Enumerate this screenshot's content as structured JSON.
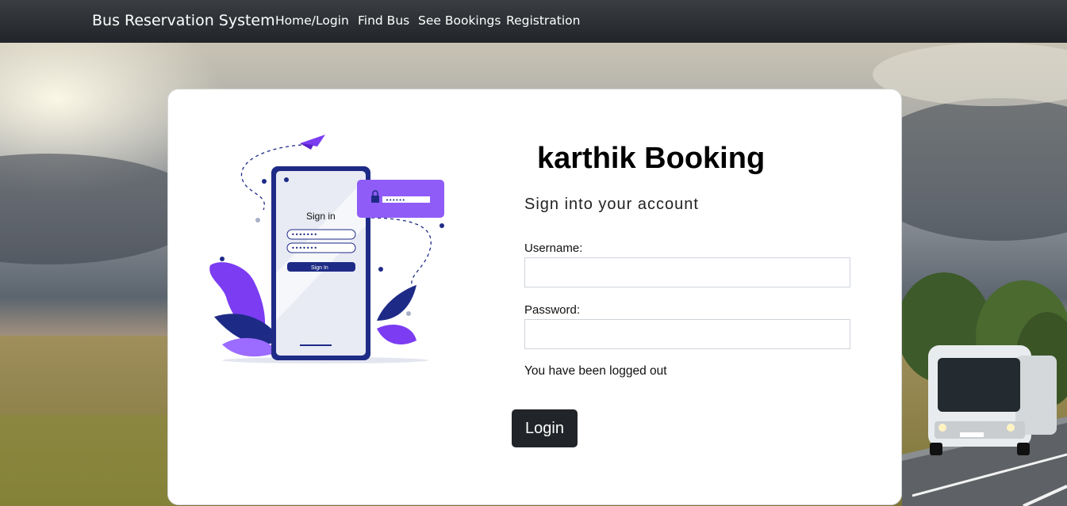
{
  "navbar": {
    "brand": "Bus Reservation System",
    "links": [
      "Home/Login",
      "Find Bus",
      "See Bookings",
      "Registration"
    ]
  },
  "login_card": {
    "title": "karthik Booking",
    "subtitle": "Sign into your account",
    "username_label": "Username:",
    "username_value": "",
    "password_label": "Password:",
    "password_value": "",
    "status_message": "You have been logged out",
    "submit_label": "Login"
  },
  "illustration": {
    "phone_title": "Sign in",
    "phone_button": "Sign In",
    "masked_password": "••••••",
    "masked_field": "•••••••"
  },
  "colors": {
    "navbar": "#212529",
    "accent": "#8f5cf7",
    "phone_frame": "#1e2b86",
    "button": "#212529"
  }
}
